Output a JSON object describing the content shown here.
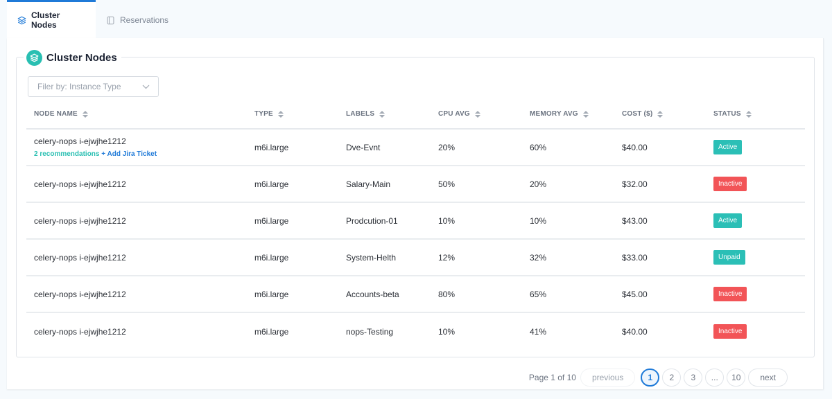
{
  "tabs": [
    {
      "label": "Cluster Nodes",
      "icon": "layers-icon",
      "active": true
    },
    {
      "label": "Reservations",
      "icon": "book-icon",
      "active": false
    }
  ],
  "section": {
    "title": "Cluster Nodes",
    "icon": "layers-icon"
  },
  "filter": {
    "placeholder": "Filer by: Instance Type",
    "icon": "chevron-down-icon"
  },
  "table": {
    "columns": [
      "NODE NAME",
      "TYPE",
      "LABELS",
      "CPU AVG",
      "MEMORY AVG",
      "COST ($)",
      "STATUS"
    ],
    "rows": [
      {
        "name": "celery-nops i-ejwjhe1212",
        "recommendations": "2 recommendations",
        "jira": "+ Add Jira Ticket",
        "type": "m6i.large",
        "label": "Dve-Evnt",
        "cpu": "20%",
        "memory": "60%",
        "cost": "$40.00",
        "status": "Active"
      },
      {
        "name": "celery-nops i-ejwjhe1212",
        "type": "m6i.large",
        "label": "Salary-Main",
        "cpu": "50%",
        "memory": "20%",
        "cost": "$32.00",
        "status": "Inactive"
      },
      {
        "name": "celery-nops i-ejwjhe1212",
        "type": "m6i.large",
        "label": "Prodcution-01",
        "cpu": "10%",
        "memory": "10%",
        "cost": "$43.00",
        "status": "Active"
      },
      {
        "name": "celery-nops i-ejwjhe1212",
        "type": "m6i.large",
        "label": "System-Helth",
        "cpu": "12%",
        "memory": "32%",
        "cost": "$33.00",
        "status": "Unpaid"
      },
      {
        "name": "celery-nops i-ejwjhe1212",
        "type": "m6i.large",
        "label": "Accounts-beta",
        "cpu": "80%",
        "memory": "65%",
        "cost": "$45.00",
        "status": "Inactive"
      },
      {
        "name": "celery-nops i-ejwjhe1212",
        "type": "m6i.large",
        "label": "nops-Testing",
        "cpu": "10%",
        "memory": "41%",
        "cost": "$40.00",
        "status": "Inactive"
      }
    ]
  },
  "pagination": {
    "info": "Page 1 of 10",
    "previous": "previous",
    "next": "next",
    "pages": [
      "1",
      "2",
      "3",
      "...",
      "10"
    ],
    "current": "1"
  },
  "colors": {
    "accent": "#1f7ad8",
    "teal": "#29bfb2",
    "active": "#2bbfb6",
    "inactive": "#f25457"
  }
}
